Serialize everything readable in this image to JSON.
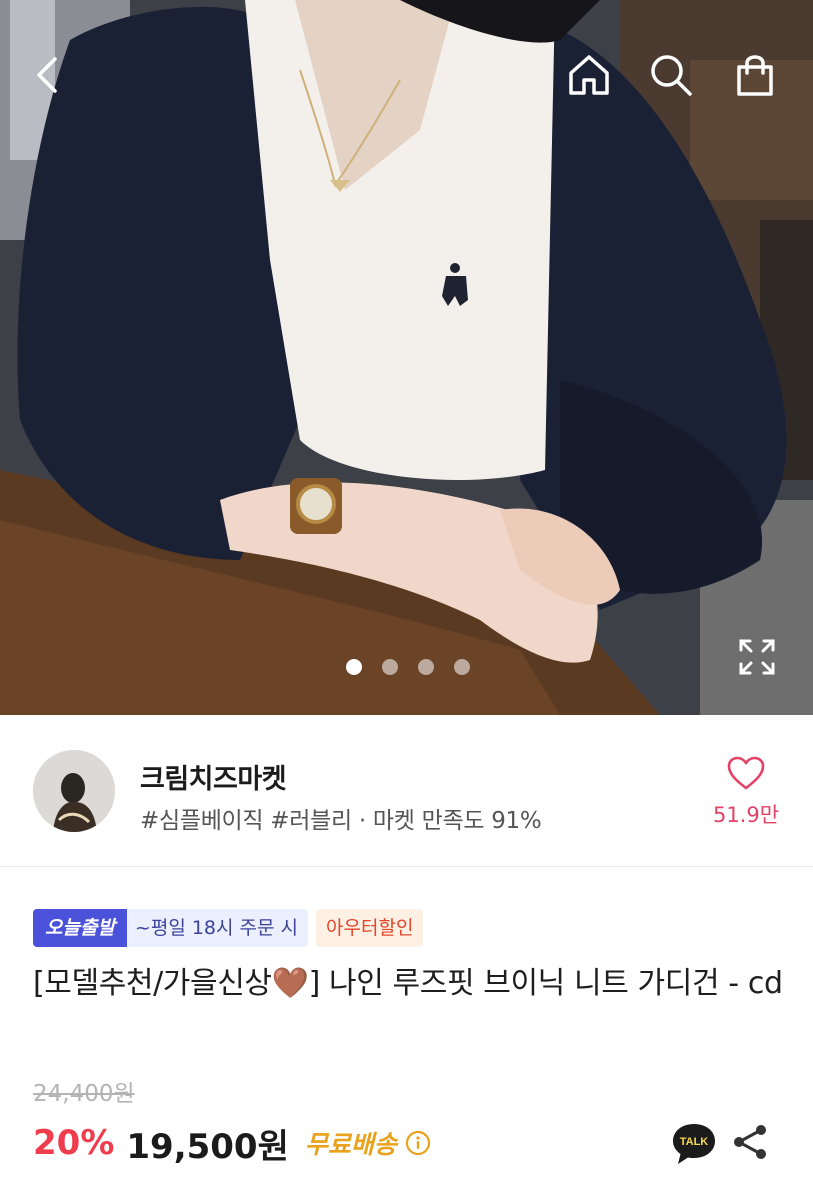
{
  "header": {
    "back_icon": "chevron-left-icon",
    "home_icon": "home-icon",
    "search_icon": "search-icon",
    "cart_icon": "shopping-bag-icon"
  },
  "gallery": {
    "image_count": 4,
    "active_index": 0,
    "expand_icon": "expand-icon"
  },
  "seller": {
    "name": "크림치즈마켓",
    "tags": "#심플베이직 #러블리 · 마켓 만족도 91%",
    "like_count": "51.9만",
    "like_icon": "heart-outline-icon"
  },
  "badges": {
    "today_ship": "오늘출발",
    "cutoff": "~평일 18시 주문 시",
    "sale": "아우터할인"
  },
  "product": {
    "title": "[모델추천/가을신상🤎] 나인 루즈핏 브이닉 니트 가디건 - cd",
    "original_price": "24,400원",
    "discount": "20%",
    "price": "19,500원",
    "shipping": "무료배송"
  },
  "actions": {
    "talk_label": "TALK",
    "share_icon": "share-icon"
  },
  "colors": {
    "accent_red": "#ef3d4e",
    "like_pink": "#e34166",
    "badge_blue": "#4a52d9",
    "shipping_gold": "#e9a21b"
  }
}
